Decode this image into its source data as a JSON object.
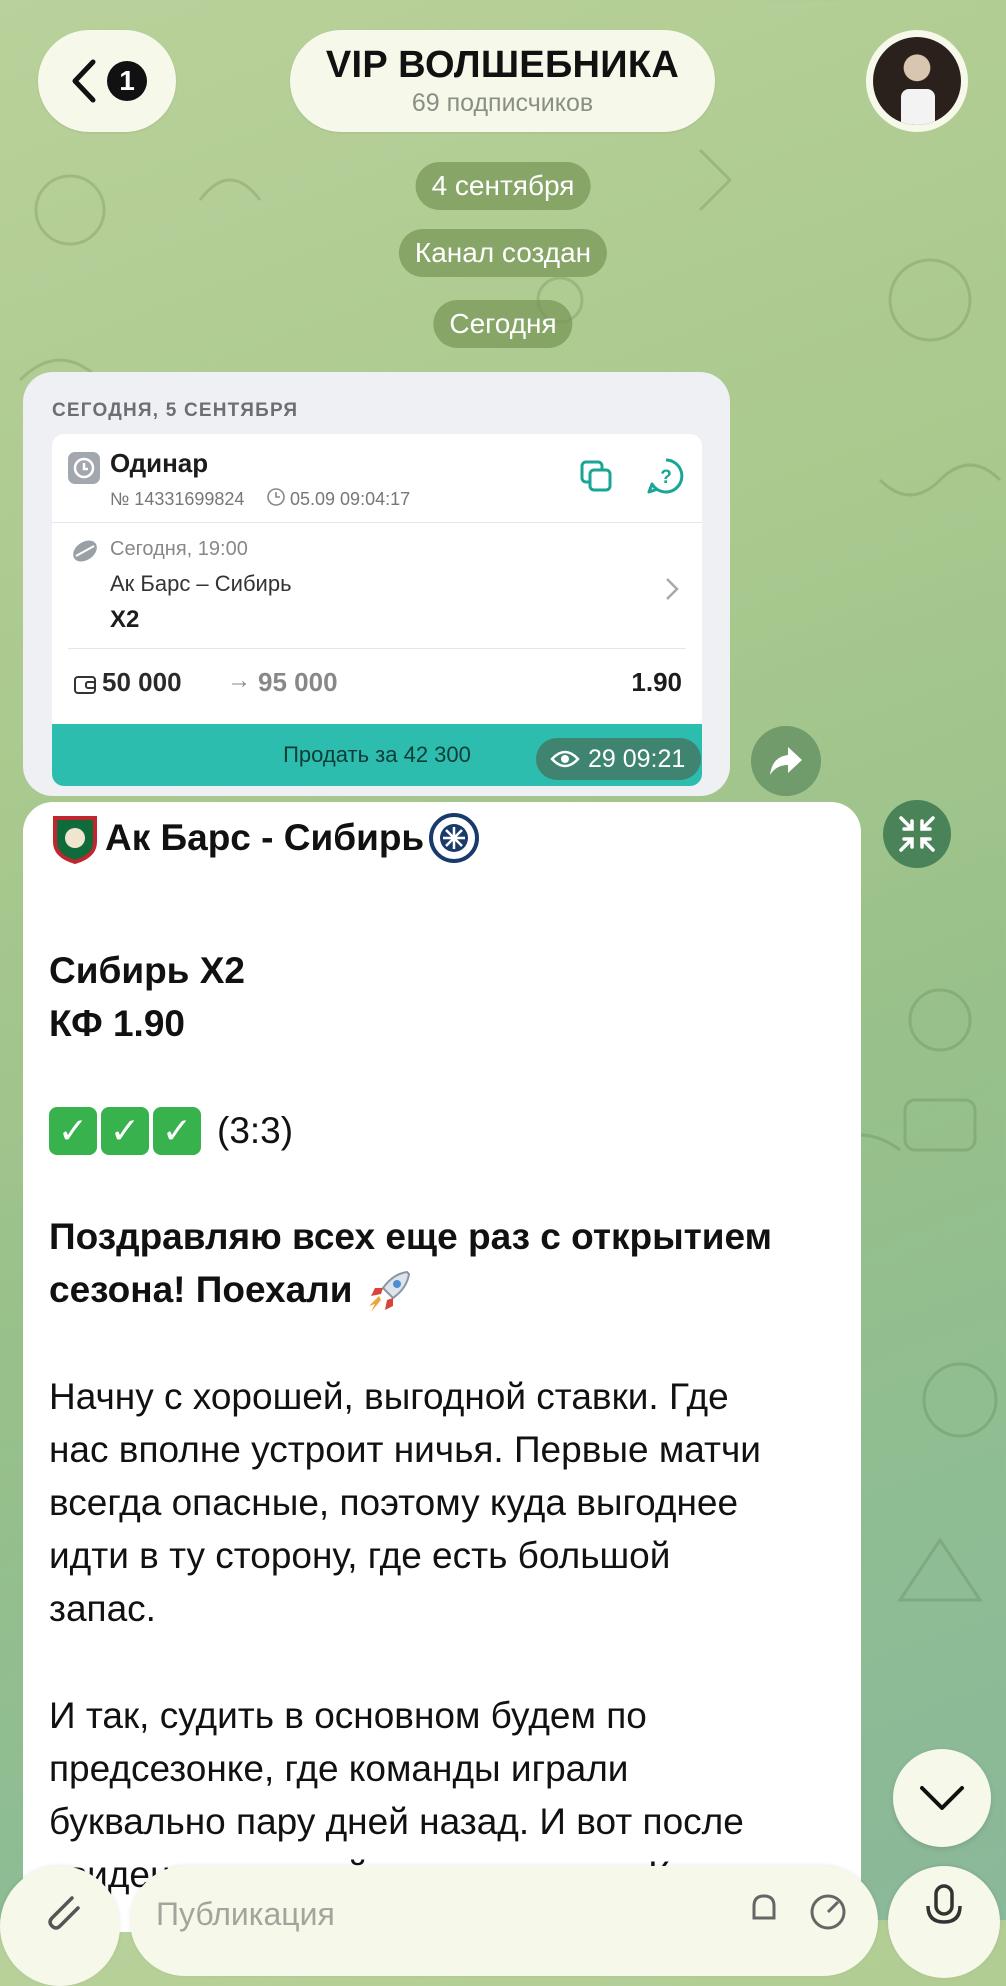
{
  "header": {
    "unread_count": "1",
    "channel_title": "VIP ВОЛШЕБНИКА",
    "subscribers": "69 подписчиков"
  },
  "service_messages": {
    "date_1": "4 сентября",
    "channel_created": "Канал создан",
    "date_2": "Сегодня"
  },
  "bet_screenshot": {
    "date_header": "СЕГОДНЯ, 5 СЕНТЯБРЯ",
    "bet_type": "Одинар",
    "bet_number": "№ 14331699824",
    "bet_datetime": "05.09 09:04:17",
    "event_time": "Сегодня, 19:00",
    "event_name": "Ак Барс – Сибирь",
    "pick": "X2",
    "stake": "50 000",
    "arrow": "→",
    "payout": "95 000",
    "odds": "1.90",
    "sell_button": "Продать за 42 300"
  },
  "message_meta": {
    "views_time": "29 09:21"
  },
  "post": {
    "title": "Ак Барс - Сибирь",
    "pick_line": "Сибирь Х2",
    "odds_line": "КФ 1.90",
    "score": "(3:3)",
    "congrats_line_1": "Поздравляю всех еще раз с открытием",
    "congrats_line_2": "сезона! Поехали",
    "p1_l1": "Начну с хорошей, выгодной ставки. Где",
    "p1_l2": "нас вполне устроит ничья. Первые матчи",
    "p1_l3": "всегда опасные, поэтому куда выгоднее",
    "p1_l4": "идти в ту сторону, где есть большой",
    "p1_l5": "запас.",
    "p2_l1": "И так, судить в основном будем по",
    "p2_l2": "предсезонке, где команды играли",
    "p2_l3": "буквально пару дней назад. И вот после",
    "p2_l4": "увиденного, давайте честно: прям Казань"
  },
  "composer": {
    "placeholder": "Публикация"
  },
  "colors": {
    "accent_teal": "#2cbdae",
    "check_green": "#37b24d",
    "chip_green": "#76965a"
  }
}
